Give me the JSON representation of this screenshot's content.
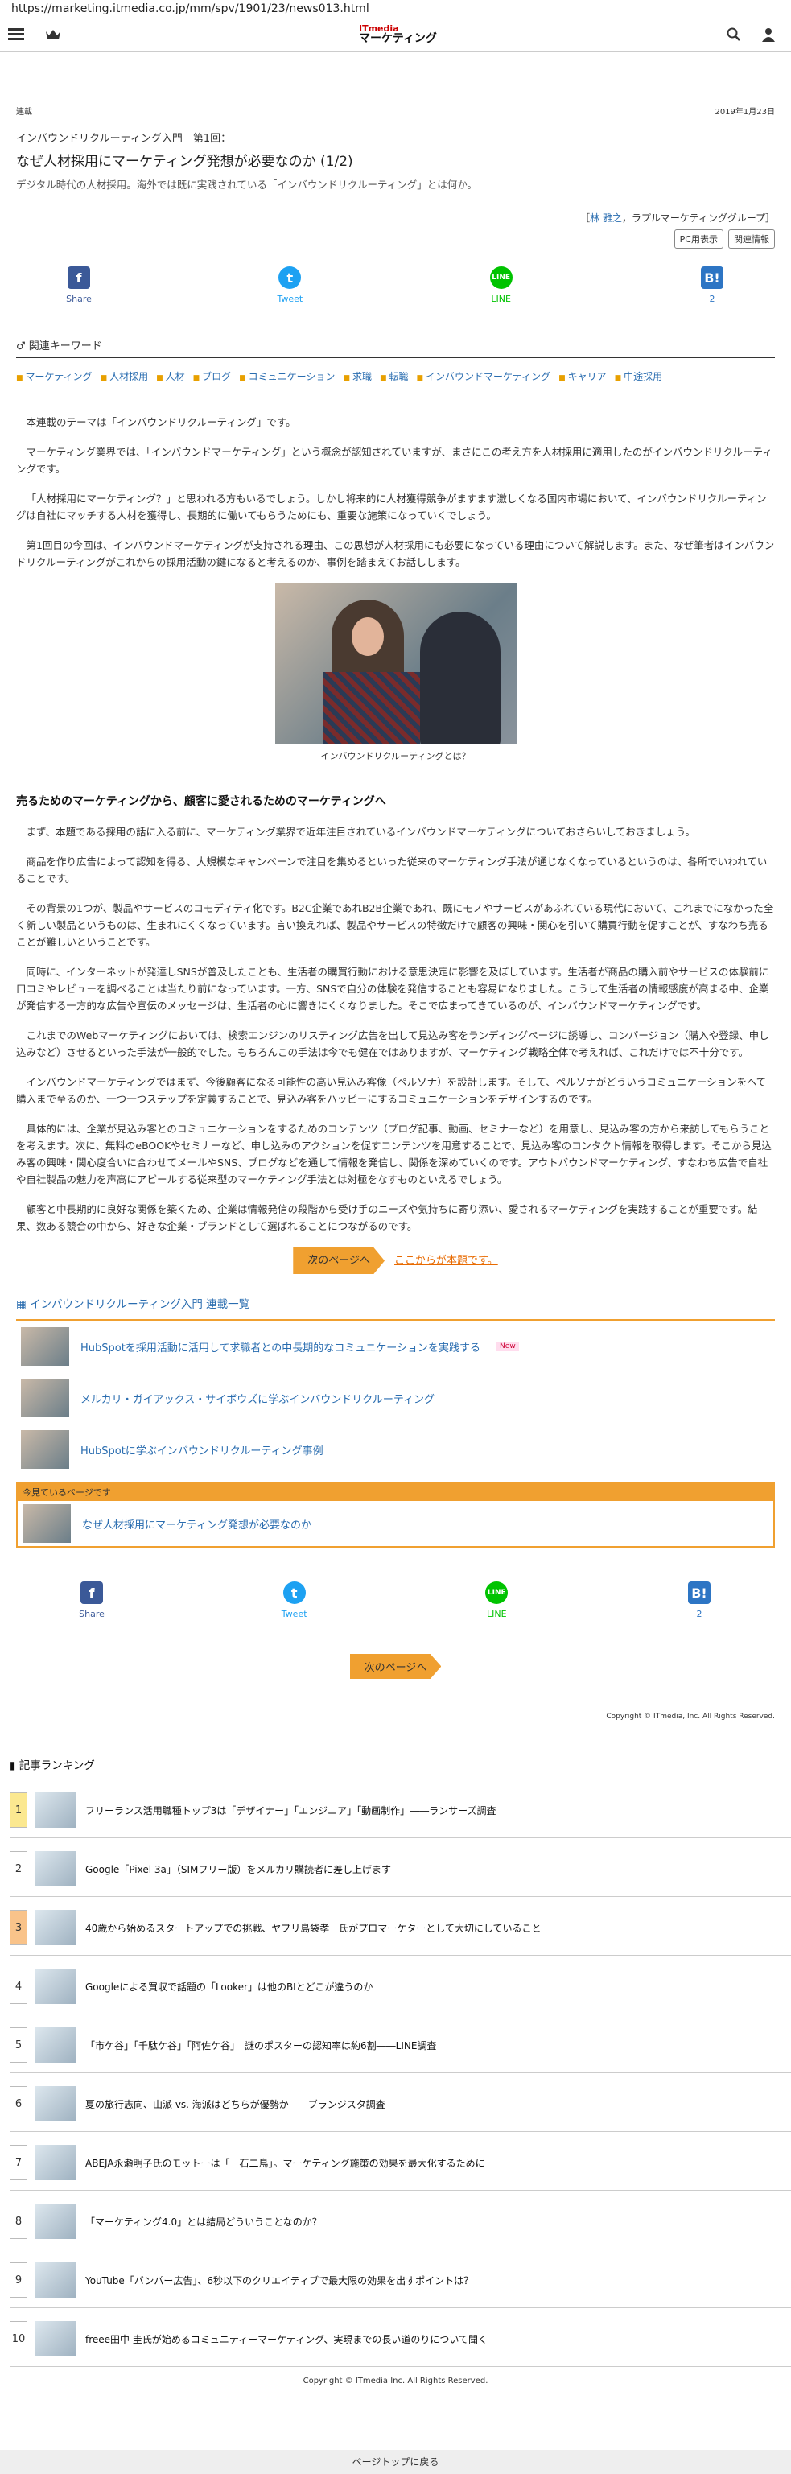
{
  "url": "https://marketing.itmedia.co.jp/mm/spv/1901/23/news013.html",
  "logo": {
    "top": "ITmedia",
    "bottom": "マーケティング"
  },
  "article": {
    "category": "連載",
    "date": "2019年1月23日",
    "series": "インバウンドリクルーティング入門　第1回：",
    "title": "なぜ人材採用にマーケティング発想が必要なのか (1/2)",
    "subtitle": "デジタル時代の人材採用。海外では既に実践されている「インバウンドリクルーティング」とは何か。",
    "author_prefix": "［",
    "author_name": "林 雅之",
    "author_suffix": "，ラプルマーケティンググループ］",
    "pc_view": "PC用表示",
    "related": "関連情報"
  },
  "share": {
    "fb": "Share",
    "tw": "Tweet",
    "line": "LINE",
    "hb": "2"
  },
  "keywords": {
    "heading": "関連キーワード",
    "items": [
      "マーケティング",
      "人材採用",
      "人材",
      "ブログ",
      "コミュニケーション",
      "求職",
      "転職",
      "インバウンドマーケティング",
      "キャリア",
      "中途採用"
    ]
  },
  "body": {
    "p1": "本連載のテーマは「インバウンドリクルーティング」です。",
    "p2": "マーケティング業界では、「インバウンドマーケティング」という概念が認知されていますが、まさにこの考え方を人材採用に適用したのがインバウンドリクルーティングです。",
    "p3": "「人材採用にマーケティング？」と思われる方もいるでしょう。しかし将来的に人材獲得競争がますます激しくなる国内市場において、インバウンドリクルーティングは自社にマッチする人材を獲得し、長期的に働いてもらうためにも、重要な施策になっていくでしょう。",
    "p4": "第1回目の今回は、インバウンドマーケティングが支持される理由、この思想が人材採用にも必要になっている理由について解説します。また、なぜ筆者はインバウンドリクルーティングがこれからの採用活動の鍵になると考えるのか、事例を踏まえてお話しします。",
    "caption": "インバウンドリクルーティングとは？",
    "heading": "売るためのマーケティングから、顧客に愛されるためのマーケティングへ",
    "p5": "まず、本題である採用の話に入る前に、マーケティング業界で近年注目されているインバウンドマーケティングについておさらいしておきましょう。",
    "p6": "商品を作り広告によって認知を得る、大規模なキャンペーンで注目を集めるといった従来のマーケティング手法が通じなくなっているというのは、各所でいわれていることです。",
    "p7": "その背景の1つが、製品やサービスのコモディティ化です。B2C企業であれB2B企業であれ、既にモノやサービスがあふれている現代において、これまでになかった全く新しい製品というものは、生まれにくくなっています。言い換えれば、製品やサービスの特徴だけで顧客の興味・関心を引いて購買行動を促すことが、すなわち売ることが難しいということです。",
    "p8": "同時に、インターネットが発達しSNSが普及したことも、生活者の購買行動における意思決定に影響を及ぼしています。生活者が商品の購入前やサービスの体験前に口コミやレビューを調べることは当たり前になっています。一方、SNSで自分の体験を発信することも容易になりました。こうして生活者の情報感度が高まる中、企業が発信する一方的な広告や宣伝のメッセージは、生活者の心に響きにくくなりました。そこで広まってきているのが、インバウンドマーケティングです。",
    "p9": "これまでのWebマーケティングにおいては、検索エンジンのリスティング広告を出して見込み客をランディングページに誘導し、コンバージョン（購入や登録、申し込みなど）させるといった手法が一般的でした。もちろんこの手法は今でも健在ではありますが、マーケティング戦略全体で考えれば、これだけでは不十分です。",
    "p10": "インバウンドマーケティングではまず、今後顧客になる可能性の高い見込み客像（ペルソナ）を設計します。そして、ペルソナがどういうコミュニケーションをへて購入まで至るのか、一つ一つステップを定義することで、見込み客をハッピーにするコミュニケーションをデザインするのです。",
    "p11": "具体的には、企業が見込み客とのコミュニケーションをするためのコンテンツ（ブログ記事、動画、セミナーなど）を用意し、見込み客の方から来訪してもらうことを考えます。次に、無料のeBOOKやセミナーなど、申し込みのアクションを促すコンテンツを用意することで、見込み客のコンタクト情報を取得します。そこから見込み客の興味・関心度合いに合わせてメールやSNS、ブログなどを通して情報を発信し、関係を深めていくのです。アウトバウンドマーケティング、すなわち広告で自社や自社製品の魅力を声高にアピールする従来型のマーケティング手法とは対極をなすものといえるでしょう。",
    "p12": "顧客と中長期的に良好な関係を築くため、企業は情報発信の段階から受け手のニーズや気持ちに寄り添い、愛されるマーケティングを実践することが重要です。結果、数ある競合の中から、好きな企業・ブランドとして選ばれることにつながるのです。"
  },
  "nav": {
    "next": "次のページへ",
    "next_link": "ここからが本題です。",
    "next2": "次のページへ"
  },
  "series_box": {
    "heading": "インバウンドリクルーティング入門 連載一覧",
    "items": [
      "HubSpotを採用活動に活用して求職者との中長期的なコミュニケーションを実践する",
      "メルカリ・ガイアックス・サイボウズに学ぶインバウンドリクルーティング",
      "HubSpotに学ぶインバウンドリクルーティング事例"
    ],
    "new_badge": "New",
    "current_label": "今見ているページです",
    "current": "なぜ人材採用にマーケティング発想が必要なのか"
  },
  "copyright": "Copyright © ITmedia, Inc. All Rights Reserved.",
  "ranking": {
    "heading": "記事ランキング",
    "items": [
      "フリーランス活用職種トップ3は「デザイナー」「エンジニア」「動画制作」――ランサーズ調査",
      "Google「Pixel 3a」（SIMフリー版）をメルカリ購読者に差し上げます",
      "40歳から始めるスタートアップでの挑戦、ヤプリ島袋孝一氏がプロマーケターとして大切にしていること",
      "Googleによる買収で話題の「Looker」は他のBIとどこが違うのか",
      "「市ケ谷」「千駄ケ谷」「阿佐ケ谷」　謎のポスターの認知率は約6割――LINE調査",
      "夏の旅行志向、山派 vs. 海派はどちらが優勢か――ブランジスタ調査",
      "ABEJA永瀬明子氏のモットーは「一石二鳥」。マーケティング施策の効果を最大化するために",
      "「マーケティング4.0」とは結局どういうことなのか？",
      "YouTube「バンパー広告」、6秒以下のクリエイティブで最大限の効果を出すポイントは？",
      "freee田中 圭氏が始めるコミュニティーマーケティング、実現までの長い道のりについて聞く"
    ]
  },
  "copyright2": "Copyright © ITmedia Inc. All Rights Reserved.",
  "page_top": "ページトップに戻る"
}
